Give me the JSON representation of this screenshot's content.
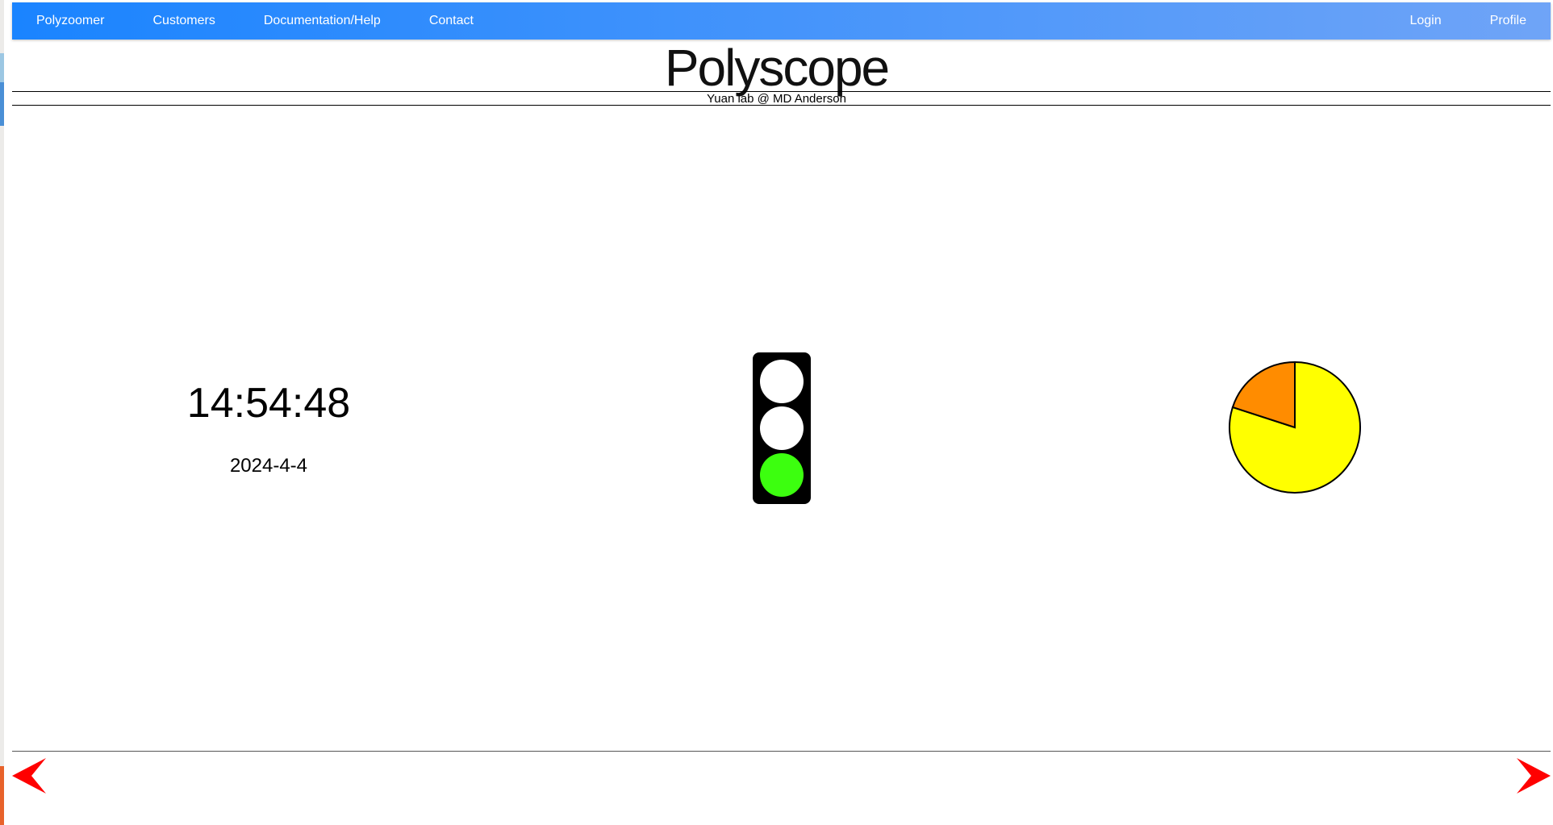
{
  "nav": {
    "left_items": [
      {
        "label": "Polyzoomer"
      },
      {
        "label": "Customers"
      },
      {
        "label": "Documentation/Help"
      },
      {
        "label": "Contact"
      }
    ],
    "right_items": [
      {
        "label": "Login"
      },
      {
        "label": "Profile"
      }
    ]
  },
  "header": {
    "title": "Polyscope",
    "subtitle": "Yuan lab @ MD Anderson"
  },
  "clock": {
    "time": "14:54:48",
    "date": "2024-4-4"
  },
  "traffic_light": {
    "active": "green",
    "lamp_colors": {
      "top": "#ffffff",
      "middle": "#ffffff",
      "bottom": "#3cff0f"
    }
  },
  "pie": {
    "slices": [
      {
        "fraction": 0.8,
        "color": "#ffff00"
      },
      {
        "fraction": 0.2,
        "color": "#ff8c00"
      }
    ]
  },
  "footer": {
    "prev_icon": "arrow-left-icon",
    "next_icon": "arrow-right-icon",
    "arrow_color": "#ff0000"
  },
  "colors": {
    "navbar_start": "#1a84ff",
    "navbar_end": "#6fa4f7"
  }
}
